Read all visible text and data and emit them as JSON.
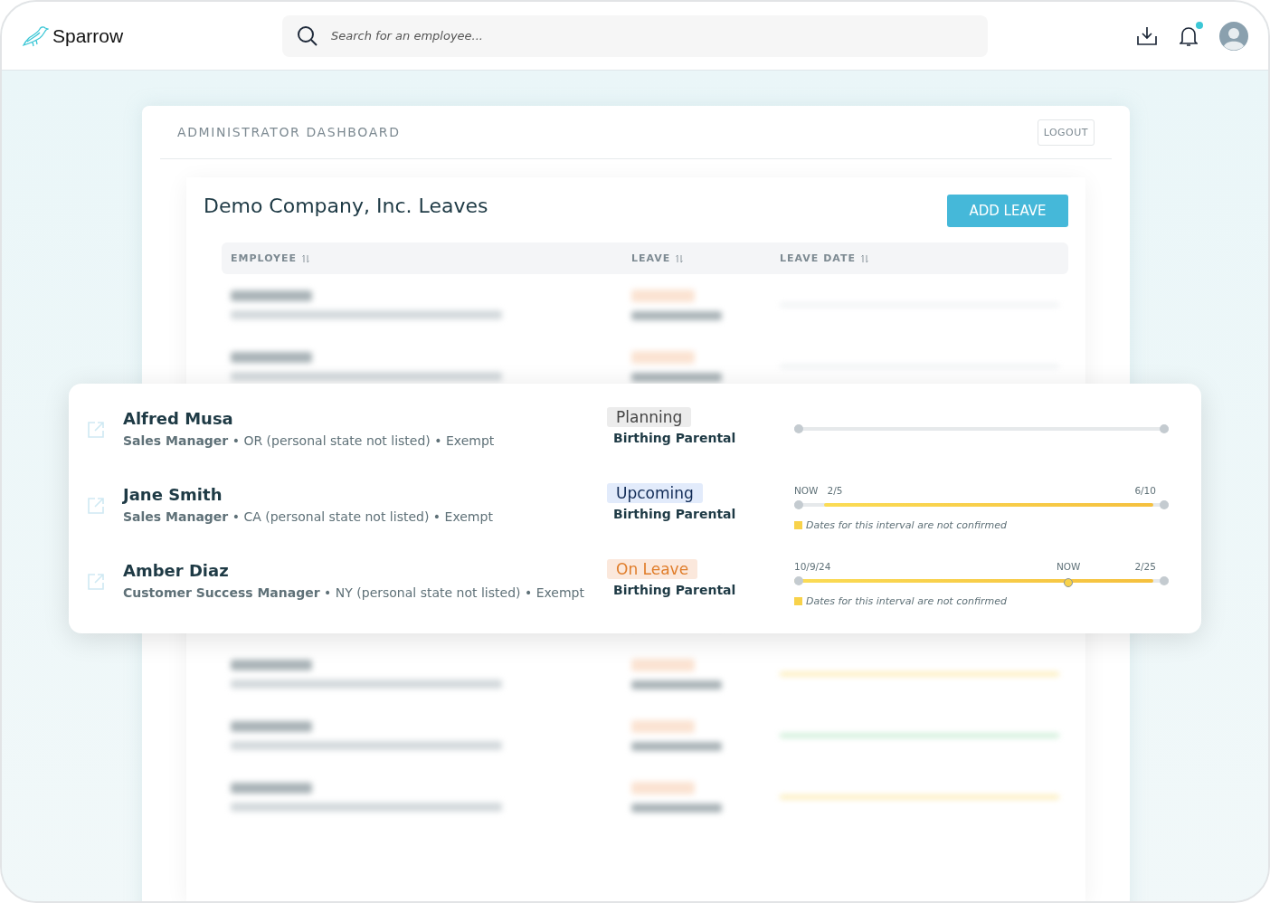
{
  "app": {
    "name": "Sparrow"
  },
  "search": {
    "placeholder": "Search for an employee..."
  },
  "notifications": {
    "unread": true
  },
  "dashboard": {
    "title": "ADMINISTRATOR DASHBOARD",
    "logout": "LOGOUT"
  },
  "leaves": {
    "title": "Demo Company, Inc. Leaves",
    "add_button": "ADD LEAVE",
    "columns": [
      "EMPLOYEE",
      "LEAVE",
      "LEAVE DATE"
    ],
    "highlighted_rows": [
      {
        "name": "Alfred Musa",
        "title": "Sales Manager",
        "details": "• OR (personal state not listed) • Exempt",
        "status": "Planning",
        "kind": "planning",
        "leave_type": "Birthing Parental",
        "timeline": {
          "kind": "empty"
        }
      },
      {
        "name": "Jane Smith",
        "title": "Sales Manager",
        "details": "• CA (personal state not listed) • Exempt",
        "status": "Upcoming",
        "kind": "upcoming",
        "leave_type": "Birthing Parental",
        "timeline": {
          "kind": "upcoming",
          "left_labels": [
            {
              "text": "NOW",
              "kind": "now"
            },
            {
              "text": "2/5",
              "kind": "date"
            }
          ],
          "right_labels": [
            {
              "text": "6/10",
              "kind": "date"
            }
          ],
          "note": "Dates for this interval are not confirmed"
        }
      },
      {
        "name": "Amber Diaz",
        "title": "Customer Success Manager",
        "details": "• NY (personal state not listed) • Exempt",
        "status": "On Leave",
        "kind": "on_leave",
        "leave_type": "Birthing Parental",
        "timeline": {
          "kind": "current",
          "left_labels": [
            {
              "text": "10/9/24",
              "kind": "date"
            }
          ],
          "right_labels": [
            {
              "text": "NOW",
              "kind": "now"
            },
            {
              "text": "2/25",
              "kind": "date"
            }
          ],
          "now_marker": true,
          "note": "Dates for this interval are not confirmed"
        }
      }
    ]
  }
}
